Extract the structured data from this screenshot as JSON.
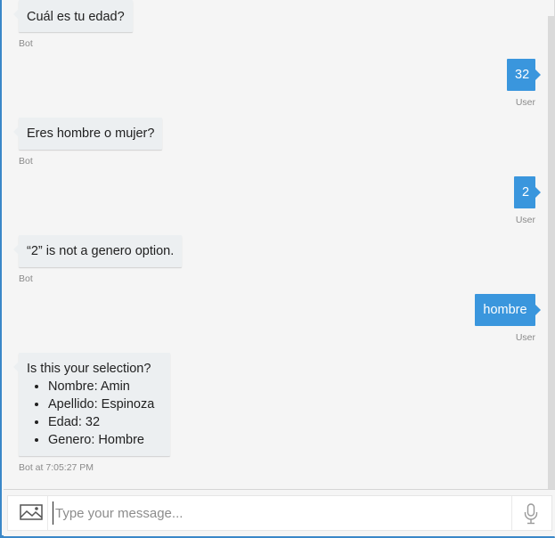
{
  "messages": [
    {
      "text": "Cuál es tu edad?",
      "sender": "Bot"
    },
    {
      "text": "32",
      "sender": "User"
    },
    {
      "text": "Eres hombre o mujer?",
      "sender": "Bot"
    },
    {
      "text": "2",
      "sender": "User"
    },
    {
      "text": "“2” is not a genero option.",
      "sender": "Bot"
    },
    {
      "text": "hombre",
      "sender": "User"
    },
    {
      "text": "Is this your selection?",
      "items": [
        "Nombre: Amin",
        "Apellido: Espinoza",
        "Edad: 32",
        "Genero: Hombre"
      ],
      "sender": "Bot at 7:05:27 PM"
    }
  ],
  "composer": {
    "placeholder": "Type your message...",
    "upload_icon": "image-icon",
    "mic_icon": "microphone-icon"
  },
  "colors": {
    "user_bubble": "#3a96dd",
    "bot_bubble": "#eceff1",
    "frame_accent": "#3a87c8"
  }
}
